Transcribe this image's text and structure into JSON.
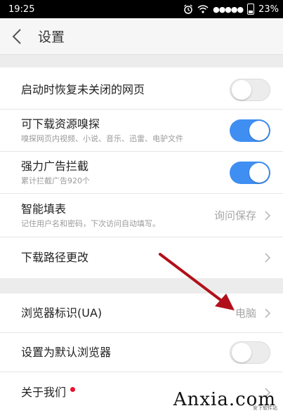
{
  "status_bar": {
    "time": "19:25",
    "signal_dots": "●●●●●",
    "battery_percent": "23%"
  },
  "header": {
    "title": "设置"
  },
  "settings": [
    {
      "label": "启动时恢复未关闭的网页",
      "toggle": false
    },
    {
      "label": "可下载资源嗅探",
      "subtitle": "嗅探网页内视频、小说、音乐、迅雷、电驴文件",
      "toggle": true
    },
    {
      "label": "强力广告拦截",
      "subtitle": "累计拦截广告920个",
      "toggle": true
    },
    {
      "label": "智能填表",
      "subtitle": "记住用户名和密码，下次访问自动填写。",
      "value": "询问保存"
    },
    {
      "label": "下载路径更改"
    },
    {
      "label": "浏览器标识(UA)",
      "value": "电脑"
    },
    {
      "label": "设置为默认浏览器",
      "toggle": false
    },
    {
      "label": "关于我们",
      "badge": true
    }
  ],
  "colors": {
    "toggle_on": "#3f8ef2",
    "arrow": "#b1101a",
    "badge": "#e8132f"
  },
  "watermark": {
    "brand": "Anxia.com",
    "sub": "安下软件站"
  }
}
